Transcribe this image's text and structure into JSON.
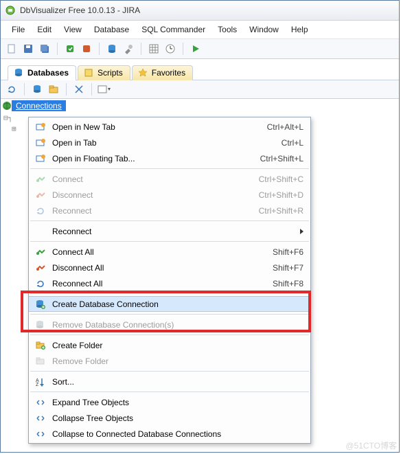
{
  "window": {
    "title": "DbVisualizer Free 10.0.13 - JIRA"
  },
  "menubar": [
    "File",
    "Edit",
    "View",
    "Database",
    "SQL Commander",
    "Tools",
    "Window",
    "Help"
  ],
  "tabs": [
    {
      "label": "Databases",
      "active": true,
      "icon": "database-icon"
    },
    {
      "label": "Scripts",
      "active": false,
      "icon": "script-icon"
    },
    {
      "label": "Favorites",
      "active": false,
      "icon": "star-icon"
    }
  ],
  "tree": {
    "root_label": "Connections"
  },
  "context_menu": [
    {
      "type": "item",
      "label": "Open in New Tab",
      "shortcut": "Ctrl+Alt+L",
      "icon": "open-tab-icon",
      "enabled": true
    },
    {
      "type": "item",
      "label": "Open in Tab",
      "shortcut": "Ctrl+L",
      "icon": "open-tab-icon",
      "enabled": true
    },
    {
      "type": "item",
      "label": "Open in Floating Tab...",
      "shortcut": "Ctrl+Shift+L",
      "icon": "open-tab-icon",
      "enabled": true
    },
    {
      "type": "sep"
    },
    {
      "type": "item",
      "label": "Connect",
      "shortcut": "Ctrl+Shift+C",
      "icon": "connect-icon",
      "enabled": false
    },
    {
      "type": "item",
      "label": "Disconnect",
      "shortcut": "Ctrl+Shift+D",
      "icon": "disconnect-icon",
      "enabled": false
    },
    {
      "type": "item",
      "label": "Reconnect",
      "shortcut": "Ctrl+Shift+R",
      "icon": "reconnect-icon",
      "enabled": false
    },
    {
      "type": "sep"
    },
    {
      "type": "submenu",
      "label": "Reconnect",
      "enabled": true
    },
    {
      "type": "sep"
    },
    {
      "type": "item",
      "label": "Connect All",
      "shortcut": "Shift+F6",
      "icon": "connect-all-icon",
      "enabled": true
    },
    {
      "type": "item",
      "label": "Disconnect All",
      "shortcut": "Shift+F7",
      "icon": "disconnect-all-icon",
      "enabled": true
    },
    {
      "type": "item",
      "label": "Reconnect All",
      "shortcut": "Shift+F8",
      "icon": "reconnect-all-icon",
      "enabled": true
    },
    {
      "type": "sep"
    },
    {
      "type": "item",
      "label": "Create Database Connection",
      "shortcut": "",
      "icon": "create-db-icon",
      "enabled": true,
      "hover": true
    },
    {
      "type": "sep"
    },
    {
      "type": "item",
      "label": "Remove Database Connection(s)",
      "shortcut": "",
      "icon": "remove-db-icon",
      "enabled": false
    },
    {
      "type": "sep"
    },
    {
      "type": "item",
      "label": "Create Folder",
      "shortcut": "",
      "icon": "create-folder-icon",
      "enabled": true
    },
    {
      "type": "item",
      "label": "Remove Folder",
      "shortcut": "",
      "icon": "remove-folder-icon",
      "enabled": false
    },
    {
      "type": "sep"
    },
    {
      "type": "item",
      "label": "Sort...",
      "shortcut": "",
      "icon": "sort-icon",
      "enabled": true
    },
    {
      "type": "sep"
    },
    {
      "type": "item",
      "label": "Expand Tree Objects",
      "shortcut": "",
      "icon": "expand-icon",
      "enabled": true
    },
    {
      "type": "item",
      "label": "Collapse Tree Objects",
      "shortcut": "",
      "icon": "collapse-icon",
      "enabled": true
    },
    {
      "type": "item",
      "label": "Collapse to Connected Database Connections",
      "shortcut": "",
      "icon": "collapse-db-icon",
      "enabled": true
    }
  ],
  "watermark": "@51CTO博客"
}
